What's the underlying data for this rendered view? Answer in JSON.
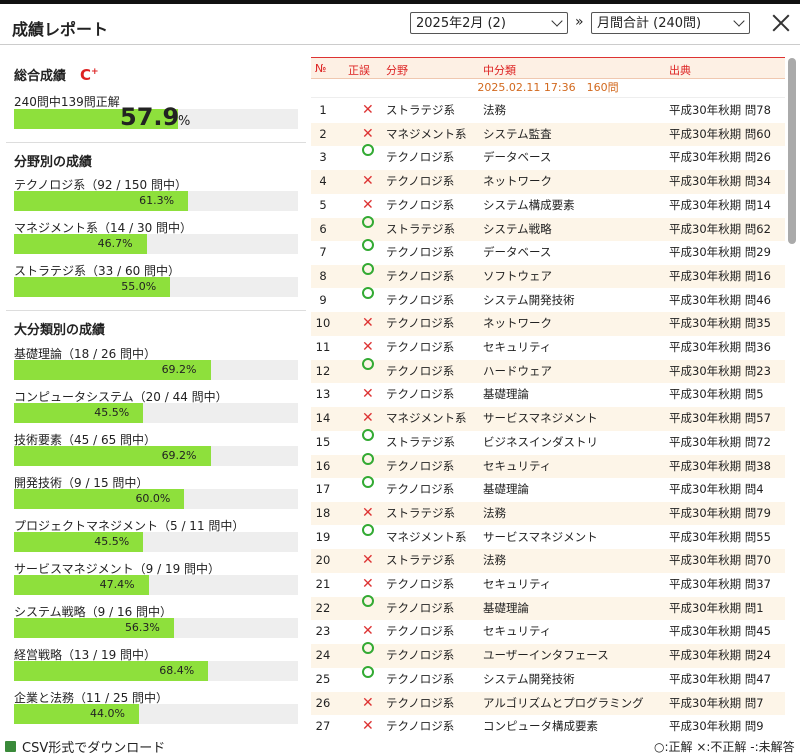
{
  "header": {
    "title": "成績レポート",
    "month_select": "2025年2月 (2)",
    "arrow": "»",
    "range_select": "月間合計 (240問)"
  },
  "summary": {
    "title": "総合成績",
    "grade": "C",
    "grade_sup": "+",
    "count_text": "240問中139問正解",
    "percent_value": 57.9,
    "percent_big": "57.9",
    "percent_sign": "%"
  },
  "fields": {
    "title": "分野別の成績",
    "items": [
      {
        "label": "テクノロジ系（92 / 150 問中）",
        "pct": "61.3%",
        "value": 61.3
      },
      {
        "label": "マネジメント系（14 / 30 問中）",
        "pct": "46.7%",
        "value": 46.7
      },
      {
        "label": "ストラテジ系（33 / 60 問中）",
        "pct": "55.0%",
        "value": 55.0
      }
    ]
  },
  "categories": {
    "title": "大分類別の成績",
    "items": [
      {
        "label": "基礎理論（18 / 26 問中）",
        "pct": "69.2%",
        "value": 69.2
      },
      {
        "label": "コンピュータシステム（20 / 44 問中）",
        "pct": "45.5%",
        "value": 45.5
      },
      {
        "label": "技術要素（45 / 65 問中）",
        "pct": "69.2%",
        "value": 69.2
      },
      {
        "label": "開発技術（9 / 15 問中）",
        "pct": "60.0%",
        "value": 60.0
      },
      {
        "label": "プロジェクトマネジメント（5 / 11 問中）",
        "pct": "45.5%",
        "value": 45.5
      },
      {
        "label": "サービスマネジメント（9 / 19 問中）",
        "pct": "47.4%",
        "value": 47.4
      },
      {
        "label": "システム戦略（9 / 16 問中）",
        "pct": "56.3%",
        "value": 56.3
      },
      {
        "label": "経営戦略（13 / 19 問中）",
        "pct": "68.4%",
        "value": 68.4
      },
      {
        "label": "企業と法務（11 / 25 問中）",
        "pct": "44.0%",
        "value": 44.0
      }
    ]
  },
  "table": {
    "headers": {
      "no": "№",
      "result": "正誤",
      "field": "分野",
      "sub": "中分類",
      "source": "出典"
    },
    "session": "2025.02.11 17:36　160問",
    "rows": [
      {
        "no": "1",
        "ok": false,
        "field": "ストラテジ系",
        "sub": "法務",
        "src": "平成30年秋期 問78"
      },
      {
        "no": "2",
        "ok": false,
        "field": "マネジメント系",
        "sub": "システム監査",
        "src": "平成30年秋期 問60"
      },
      {
        "no": "3",
        "ok": true,
        "field": "テクノロジ系",
        "sub": "データベース",
        "src": "平成30年秋期 問26"
      },
      {
        "no": "4",
        "ok": false,
        "field": "テクノロジ系",
        "sub": "ネットワーク",
        "src": "平成30年秋期 問34"
      },
      {
        "no": "5",
        "ok": false,
        "field": "テクノロジ系",
        "sub": "システム構成要素",
        "src": "平成30年秋期 問14"
      },
      {
        "no": "6",
        "ok": true,
        "field": "ストラテジ系",
        "sub": "システム戦略",
        "src": "平成30年秋期 問62"
      },
      {
        "no": "7",
        "ok": true,
        "field": "テクノロジ系",
        "sub": "データベース",
        "src": "平成30年秋期 問29"
      },
      {
        "no": "8",
        "ok": true,
        "field": "テクノロジ系",
        "sub": "ソフトウェア",
        "src": "平成30年秋期 問16"
      },
      {
        "no": "9",
        "ok": true,
        "field": "テクノロジ系",
        "sub": "システム開発技術",
        "src": "平成30年秋期 問46"
      },
      {
        "no": "10",
        "ok": false,
        "field": "テクノロジ系",
        "sub": "ネットワーク",
        "src": "平成30年秋期 問35"
      },
      {
        "no": "11",
        "ok": false,
        "field": "テクノロジ系",
        "sub": "セキュリティ",
        "src": "平成30年秋期 問36"
      },
      {
        "no": "12",
        "ok": true,
        "field": "テクノロジ系",
        "sub": "ハードウェア",
        "src": "平成30年秋期 問23"
      },
      {
        "no": "13",
        "ok": false,
        "field": "テクノロジ系",
        "sub": "基礎理論",
        "src": "平成30年秋期 問5"
      },
      {
        "no": "14",
        "ok": false,
        "field": "マネジメント系",
        "sub": "サービスマネジメント",
        "src": "平成30年秋期 問57"
      },
      {
        "no": "15",
        "ok": true,
        "field": "ストラテジ系",
        "sub": "ビジネスインダストリ",
        "src": "平成30年秋期 問72"
      },
      {
        "no": "16",
        "ok": true,
        "field": "テクノロジ系",
        "sub": "セキュリティ",
        "src": "平成30年秋期 問38"
      },
      {
        "no": "17",
        "ok": true,
        "field": "テクノロジ系",
        "sub": "基礎理論",
        "src": "平成30年秋期 問4"
      },
      {
        "no": "18",
        "ok": false,
        "field": "ストラテジ系",
        "sub": "法務",
        "src": "平成30年秋期 問79"
      },
      {
        "no": "19",
        "ok": true,
        "field": "マネジメント系",
        "sub": "サービスマネジメント",
        "src": "平成30年秋期 問55"
      },
      {
        "no": "20",
        "ok": false,
        "field": "ストラテジ系",
        "sub": "法務",
        "src": "平成30年秋期 問70"
      },
      {
        "no": "21",
        "ok": false,
        "field": "テクノロジ系",
        "sub": "セキュリティ",
        "src": "平成30年秋期 問37"
      },
      {
        "no": "22",
        "ok": true,
        "field": "テクノロジ系",
        "sub": "基礎理論",
        "src": "平成30年秋期 問1"
      },
      {
        "no": "23",
        "ok": false,
        "field": "テクノロジ系",
        "sub": "セキュリティ",
        "src": "平成30年秋期 問45"
      },
      {
        "no": "24",
        "ok": true,
        "field": "テクノロジ系",
        "sub": "ユーザーインタフェース",
        "src": "平成30年秋期 問24"
      },
      {
        "no": "25",
        "ok": true,
        "field": "テクノロジ系",
        "sub": "システム開発技術",
        "src": "平成30年秋期 問47"
      },
      {
        "no": "26",
        "ok": false,
        "field": "テクノロジ系",
        "sub": "アルゴリズムとプログラミング",
        "src": "平成30年秋期 問7"
      },
      {
        "no": "27",
        "ok": false,
        "field": "テクノロジ系",
        "sub": "コンピュータ構成要素",
        "src": "平成30年秋期 問9"
      }
    ]
  },
  "footer": {
    "csv_label": "CSV形式でダウンロード",
    "legend": "○:正解 ×:不正解 -:未解答"
  },
  "colors": {
    "accent": "#dd2222",
    "bar": "#8ee03c",
    "correct": "#33aa33",
    "wrong": "#dd3333"
  },
  "icons": {
    "close": "close-icon",
    "csv": "csv-file-icon",
    "chevron": "chevron-down-icon"
  }
}
